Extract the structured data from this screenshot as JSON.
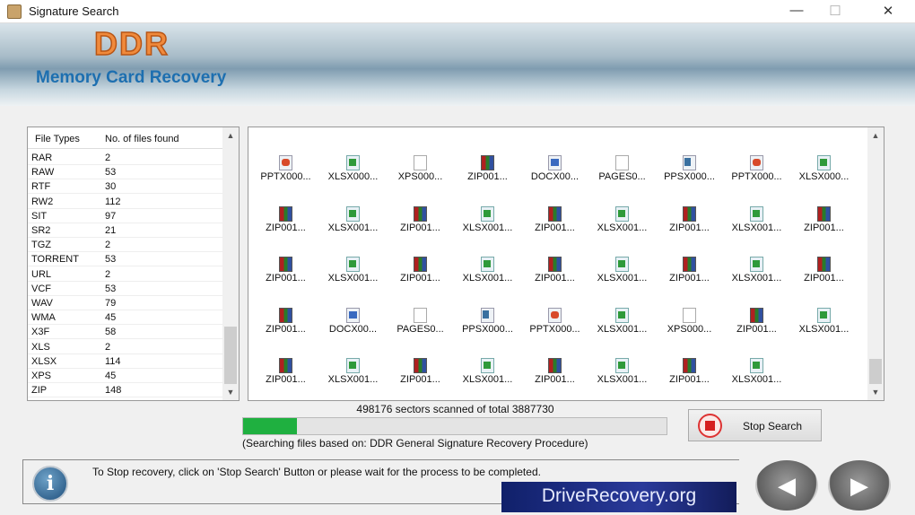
{
  "window": {
    "title": "Signature Search",
    "minimize": "—",
    "maximize": "☐",
    "close": "✕"
  },
  "banner": {
    "brand": "DDR",
    "product": "Memory Card Recovery"
  },
  "file_table": {
    "headers": [
      "File Types",
      "No. of files found"
    ],
    "rows": [
      [
        "RAR",
        "2"
      ],
      [
        "RAW",
        "53"
      ],
      [
        "RTF",
        "30"
      ],
      [
        "RW2",
        "112"
      ],
      [
        "SIT",
        "97"
      ],
      [
        "SR2",
        "21"
      ],
      [
        "TGZ",
        "2"
      ],
      [
        "TORRENT",
        "53"
      ],
      [
        "URL",
        "2"
      ],
      [
        "VCF",
        "53"
      ],
      [
        "WAV",
        "79"
      ],
      [
        "WMA",
        "45"
      ],
      [
        "X3F",
        "58"
      ],
      [
        "XLS",
        "2"
      ],
      [
        "XLSX",
        "114"
      ],
      [
        "XPS",
        "45"
      ],
      [
        "ZIP",
        "148"
      ]
    ]
  },
  "files": [
    [
      {
        "n": "PPTX000...",
        "t": "pptx"
      },
      {
        "n": "XLSX000...",
        "t": "xlsx"
      },
      {
        "n": "XPS000...",
        "t": "blank"
      },
      {
        "n": "ZIP001...",
        "t": "zip"
      },
      {
        "n": "DOCX00...",
        "t": "docx"
      },
      {
        "n": "PAGES0...",
        "t": "blank"
      },
      {
        "n": "PPSX000...",
        "t": "ppsx"
      },
      {
        "n": "PPTX000...",
        "t": "pptx"
      },
      {
        "n": "XLSX000...",
        "t": "xlsx"
      }
    ],
    [
      {
        "n": "ZIP001...",
        "t": "zip"
      },
      {
        "n": "XLSX001...",
        "t": "xlsx"
      },
      {
        "n": "ZIP001...",
        "t": "zip"
      },
      {
        "n": "XLSX001...",
        "t": "xlsx"
      },
      {
        "n": "ZIP001...",
        "t": "zip"
      },
      {
        "n": "XLSX001...",
        "t": "xlsx"
      },
      {
        "n": "ZIP001...",
        "t": "zip"
      },
      {
        "n": "XLSX001...",
        "t": "xlsx"
      },
      {
        "n": "ZIP001...",
        "t": "zip"
      }
    ],
    [
      {
        "n": "ZIP001...",
        "t": "zip"
      },
      {
        "n": "XLSX001...",
        "t": "xlsx"
      },
      {
        "n": "ZIP001...",
        "t": "zip"
      },
      {
        "n": "XLSX001...",
        "t": "xlsx"
      },
      {
        "n": "ZIP001...",
        "t": "zip"
      },
      {
        "n": "XLSX001...",
        "t": "xlsx"
      },
      {
        "n": "ZIP001...",
        "t": "zip"
      },
      {
        "n": "XLSX001...",
        "t": "xlsx"
      },
      {
        "n": "ZIP001...",
        "t": "zip"
      }
    ],
    [
      {
        "n": "ZIP001...",
        "t": "zip"
      },
      {
        "n": "DOCX00...",
        "t": "docx"
      },
      {
        "n": "PAGES0...",
        "t": "blank"
      },
      {
        "n": "PPSX000...",
        "t": "ppsx"
      },
      {
        "n": "PPTX000...",
        "t": "pptx"
      },
      {
        "n": "XLSX001...",
        "t": "xlsx"
      },
      {
        "n": "XPS000...",
        "t": "blank"
      },
      {
        "n": "ZIP001...",
        "t": "zip"
      },
      {
        "n": "XLSX001...",
        "t": "xlsx"
      }
    ],
    [
      {
        "n": "ZIP001...",
        "t": "zip"
      },
      {
        "n": "XLSX001...",
        "t": "xlsx"
      },
      {
        "n": "ZIP001...",
        "t": "zip"
      },
      {
        "n": "XLSX001...",
        "t": "xlsx"
      },
      {
        "n": "ZIP001...",
        "t": "zip"
      },
      {
        "n": "XLSX001...",
        "t": "xlsx"
      },
      {
        "n": "ZIP001...",
        "t": "zip"
      },
      {
        "n": "XLSX001...",
        "t": "xlsx"
      }
    ]
  ],
  "progress": {
    "status": "498176 sectors scanned of total 3887730",
    "scanned": 498176,
    "total": 3887730,
    "percent": 12.8,
    "method": "(Searching files based on:  DDR General Signature Recovery Procedure)"
  },
  "stop_button": "Stop Search",
  "info": {
    "text": "To Stop recovery, click on 'Stop Search' Button or please wait for the process to be completed.",
    "icon": "i"
  },
  "logo": "DriveRecovery.org",
  "nav": {
    "back": "◀",
    "next": "▶"
  }
}
